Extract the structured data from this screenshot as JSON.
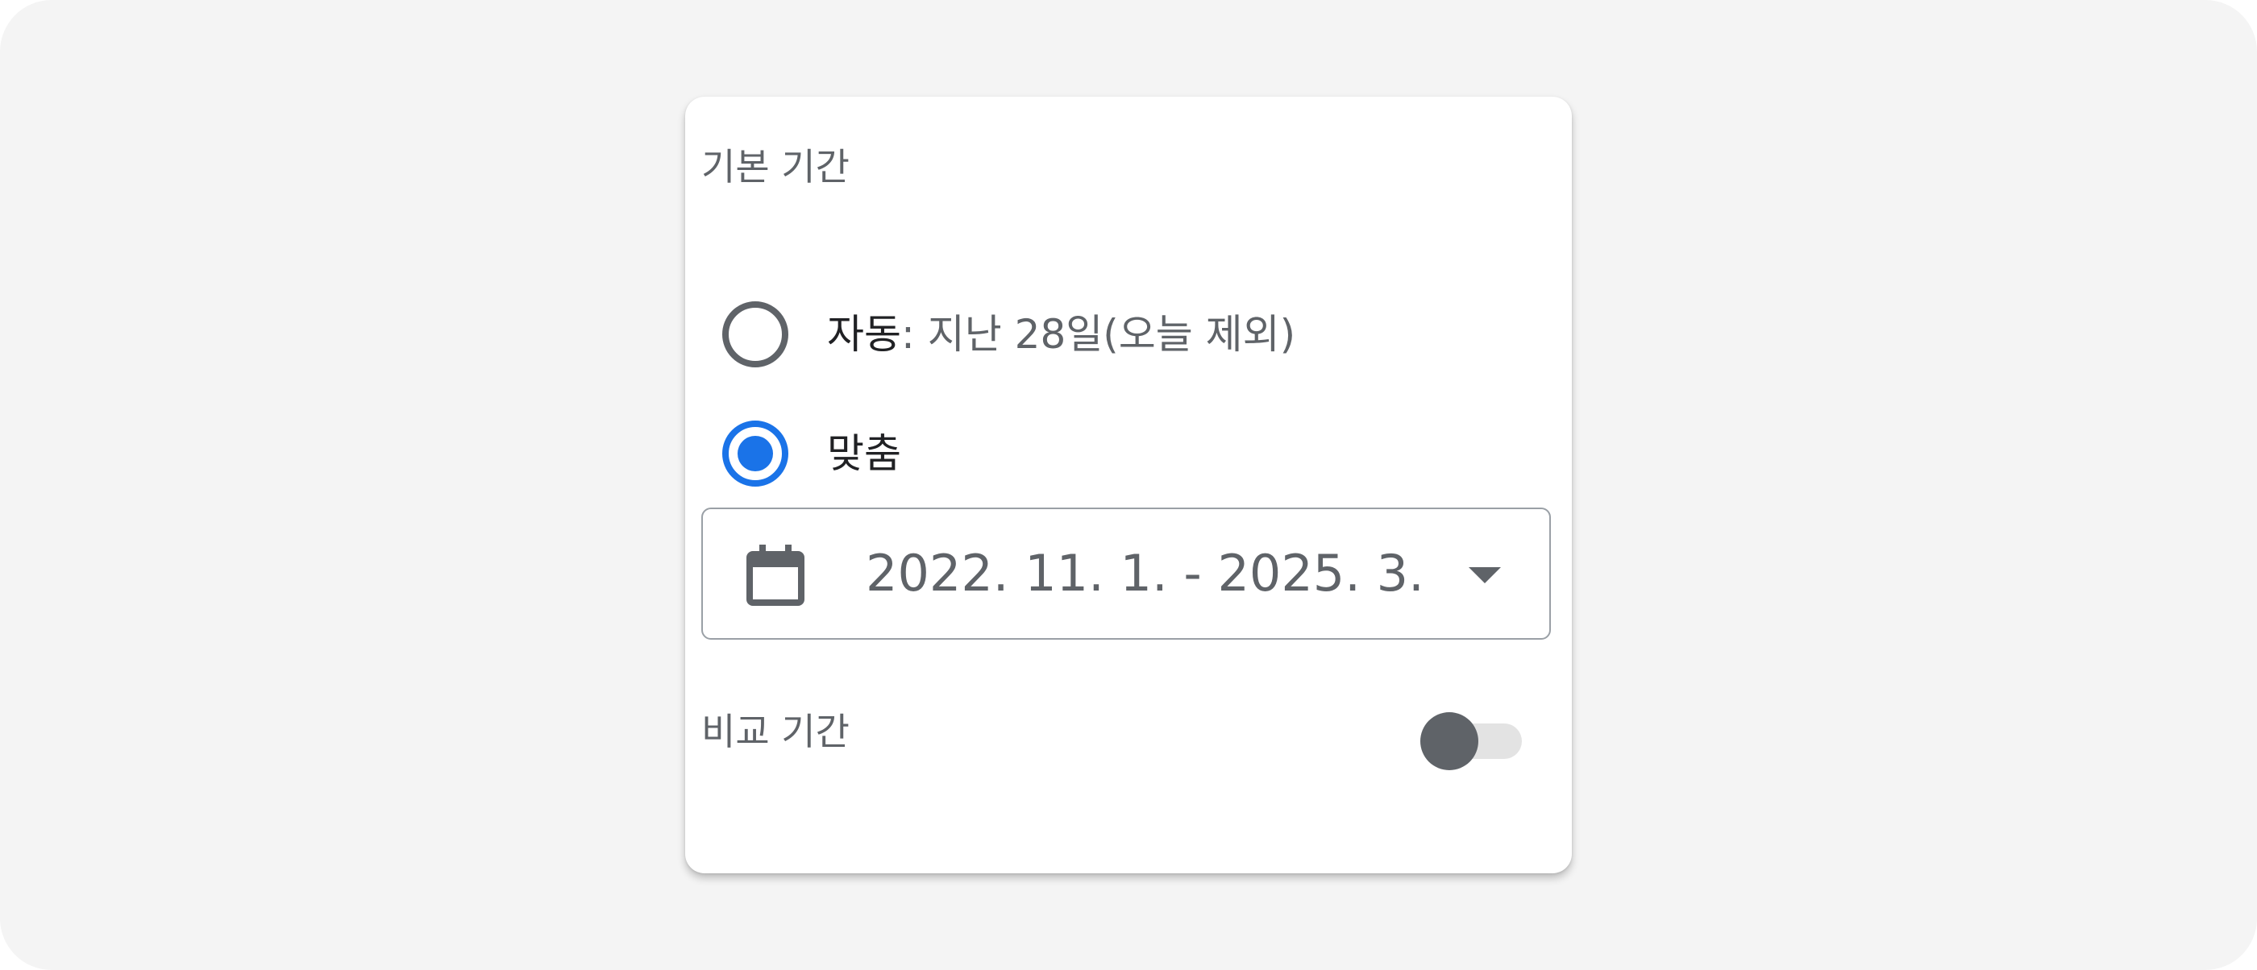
{
  "default_period": {
    "title": "기본 기간",
    "options": [
      {
        "label": "자동",
        "detail": ": 지난 28일(오늘 제외)",
        "selected": false
      },
      {
        "label": "맞춤",
        "detail": "",
        "selected": true
      }
    ],
    "date_range": {
      "value": "2022. 11. 1. - 2025. 3. 1...",
      "icon": "calendar-icon",
      "dropdown_icon": "arrow-drop-down-icon"
    }
  },
  "compare_period": {
    "title": "비교 기간",
    "enabled": false
  },
  "colors": {
    "accent": "#1a73e8",
    "text_primary": "#202124",
    "text_secondary": "#5f6368",
    "background": "#f4f4f4"
  }
}
